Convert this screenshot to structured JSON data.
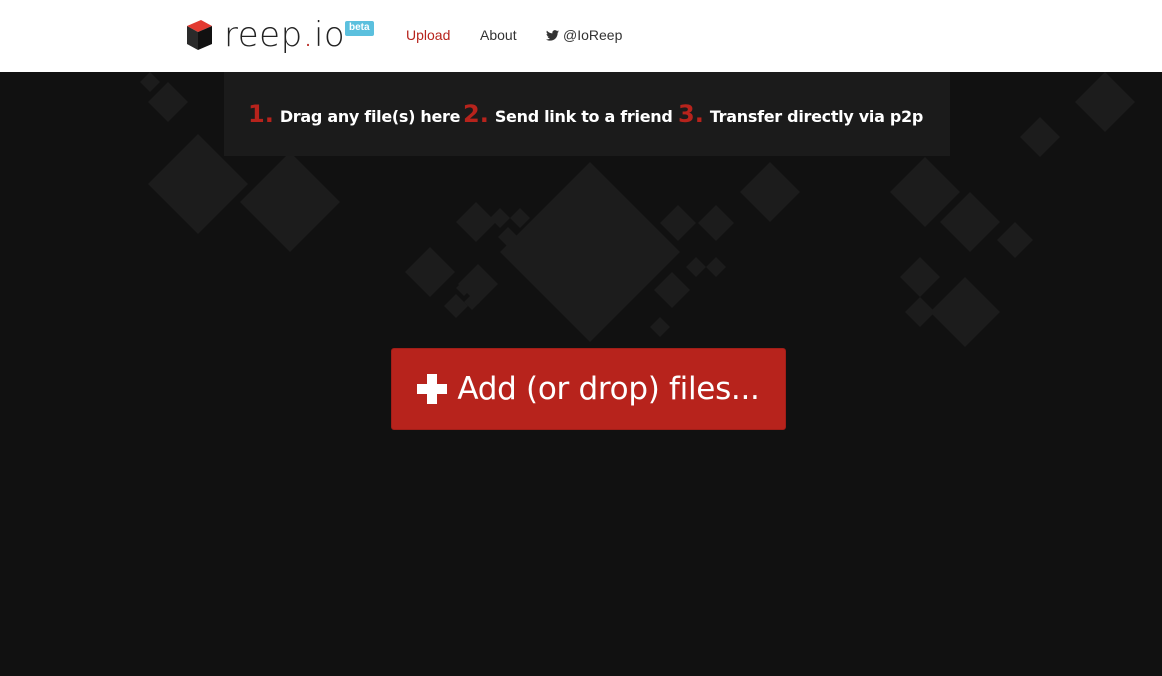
{
  "brand": {
    "name_prefix": "reep",
    "name_dot": ".",
    "name_suffix": "io",
    "badge": "beta"
  },
  "nav": {
    "items": [
      {
        "label": "Upload",
        "active": true
      },
      {
        "label": "About",
        "active": false
      },
      {
        "label": "@IoReep",
        "icon": "twitter-icon"
      }
    ]
  },
  "steps": [
    {
      "number": "1.",
      "text": "Drag any file(s) here"
    },
    {
      "number": "2.",
      "text": "Send link to a friend"
    },
    {
      "number": "3.",
      "text": "Transfer directly via p2p"
    }
  ],
  "upload_button": {
    "icon": "plus-icon",
    "label": "Add (or drop) files..."
  },
  "colors": {
    "accent": "#b7231c",
    "badge": "#5bc0de",
    "background": "#111111",
    "navbar": "#ffffff",
    "pattern": "#1c1c1c"
  }
}
